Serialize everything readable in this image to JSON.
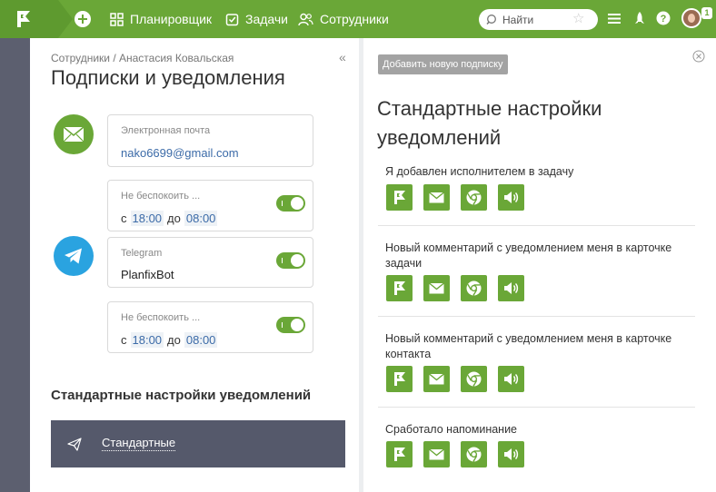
{
  "topbar": {
    "nav": [
      {
        "label": "Планировщик"
      },
      {
        "label": "Задачи"
      },
      {
        "label": "Сотрудники"
      }
    ],
    "search_placeholder": "Найти",
    "badge": "1",
    "accent": "#6aa737"
  },
  "left": {
    "breadcrumb": "Сотрудники / Анастасия Ковальская",
    "collapse_glyph": "«",
    "title": "Подписки и уведомления",
    "email": {
      "label": "Электронная почта",
      "value": "nako6699@gmail.com"
    },
    "dnd1": {
      "label": "Не беспокоить ...",
      "from_label": "с",
      "from": "18:00",
      "to_label": "до",
      "to": "08:00",
      "enabled": true
    },
    "telegram": {
      "label": "Telegram",
      "value": "PlanfixBot",
      "enabled": true
    },
    "dnd2": {
      "label": "Не беспокоить ...",
      "from_label": "с",
      "from": "18:00",
      "to_label": "до",
      "to": "08:00",
      "enabled": true
    },
    "section_title": "Стандартные настройки уведомлений",
    "std_item": "Стандартные"
  },
  "right": {
    "add_button": "Добавить новую подписку",
    "title": "Стандартные настройки уведомлений",
    "events": [
      {
        "title": "Я добавлен исполнителем в задачу"
      },
      {
        "title": "Новый комментарий с уведомлением меня в карточке задачи"
      },
      {
        "title": "Новый комментарий с уведомлением меня в карточке контакта"
      },
      {
        "title": "Сработало напоминание"
      }
    ],
    "channels": [
      "flag-icon",
      "mail-icon",
      "chrome-icon",
      "sound-icon"
    ]
  }
}
